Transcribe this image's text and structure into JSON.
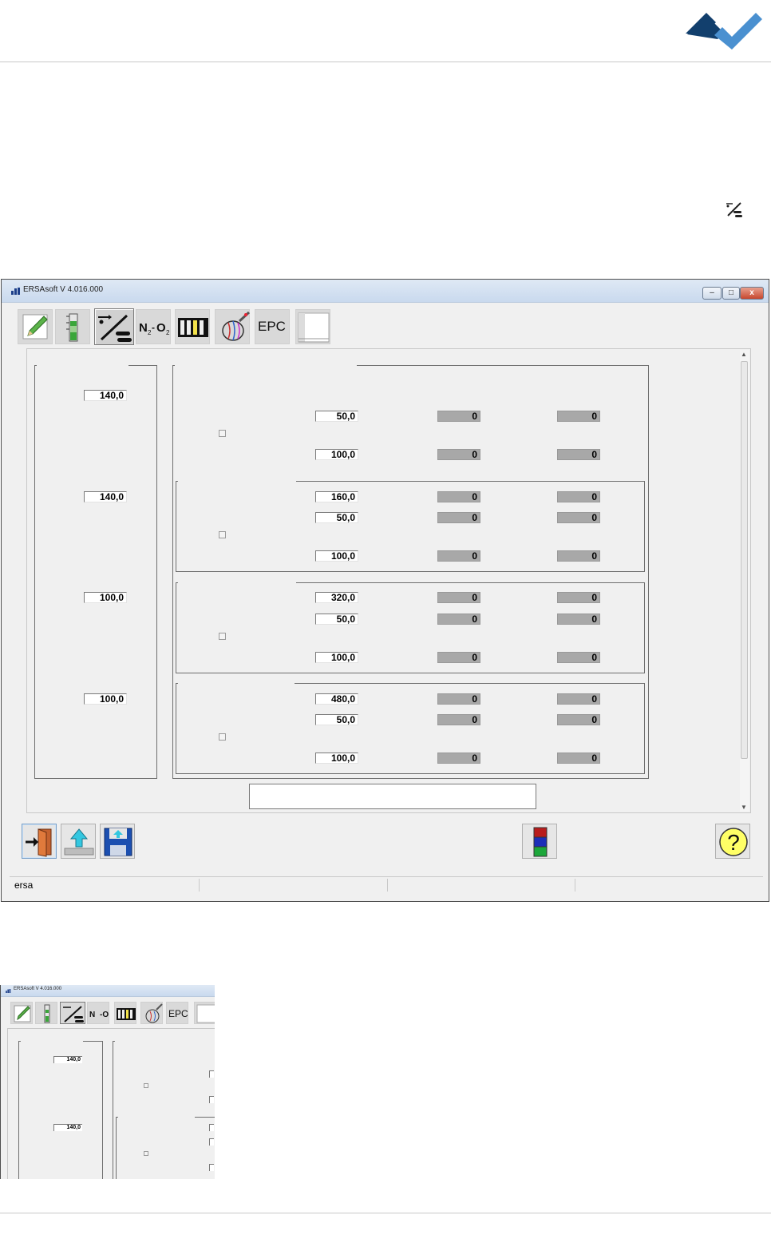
{
  "window": {
    "title": "ERSAsoft V 4.016.000",
    "controls": {
      "minimize": "–",
      "maximize": "□",
      "close": "x"
    }
  },
  "toolbar": {
    "items": [
      {
        "icon": "pencil-icon"
      },
      {
        "icon": "thermometer-icon"
      },
      {
        "icon": "conveyor-icon",
        "active": true
      },
      {
        "icon": "n2-o2-icon",
        "label": "N",
        "label_sub": "2",
        "label_sep": "-",
        "label2": "O",
        "label2_sub": "2"
      },
      {
        "icon": "heater-bars-icon"
      },
      {
        "icon": "flux-nozzle-icon"
      },
      {
        "icon": "epc-icon",
        "label": "EPC"
      },
      {
        "icon": "table-grid-icon"
      }
    ]
  },
  "left_panel": {
    "values": [
      "140,0",
      "140,0",
      "100,0",
      "100,0"
    ]
  },
  "zones": [
    {
      "rows": [
        [
          "50,0",
          "0",
          "0"
        ],
        [
          "100,0",
          "0",
          "0"
        ]
      ]
    },
    {
      "rows": [
        [
          "160,0",
          "0",
          "0"
        ],
        [
          "50,0",
          "0",
          "0"
        ],
        [
          "100,0",
          "0",
          "0"
        ]
      ]
    },
    {
      "rows": [
        [
          "320,0",
          "0",
          "0"
        ],
        [
          "50,0",
          "0",
          "0"
        ],
        [
          "100,0",
          "0",
          "0"
        ]
      ]
    },
    {
      "rows": [
        [
          "480,0",
          "0",
          "0"
        ],
        [
          "50,0",
          "0",
          "0"
        ],
        [
          "100,0",
          "0",
          "0"
        ]
      ]
    }
  ],
  "bottom_buttons": [
    "exit-door-icon",
    "upload-icon",
    "save-disk-icon",
    "color-status-icon",
    "help-icon"
  ],
  "help_label": "?",
  "status_bar": {
    "user": "ersa"
  },
  "preview": {
    "title": "ERSAsoft V 4.016.000",
    "epc_label": "EPC",
    "n2_label": "N",
    "values": [
      "140,0",
      "140,0"
    ]
  },
  "colors": {
    "logo_dark": "#123f6d",
    "logo_light": "#4a90d0",
    "gray_field": "#a8a8a8",
    "help_yellow": "#ffff66"
  }
}
